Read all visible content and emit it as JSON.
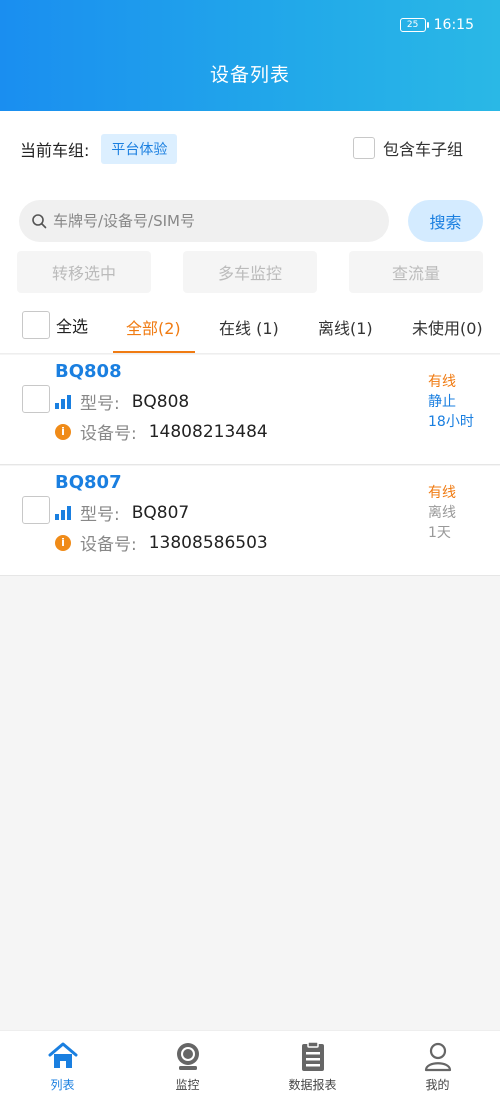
{
  "status_bar": {
    "battery": "25",
    "time": "16:15"
  },
  "header": {
    "title": "设备列表"
  },
  "group": {
    "label": "当前车组:",
    "value": "平台体验",
    "include_subgroup": "包含车子组"
  },
  "search": {
    "placeholder": "车牌号/设备号/SIM号",
    "button": "搜索"
  },
  "actions": [
    "转移选中",
    "多车监控",
    "查流量"
  ],
  "tabs": {
    "select_all": "全选",
    "items": [
      "全部(2)",
      "在线 (1)",
      "离线(1)",
      "未使用(0)"
    ],
    "active": 0
  },
  "devices": [
    {
      "plate": "BQ808",
      "model_label": "型号:",
      "model": "BQ808",
      "imei_label": "设备号:",
      "imei": "14808213484",
      "status": [
        "有线",
        "静止",
        "18小时"
      ]
    },
    {
      "plate": "BQ807",
      "model_label": "型号:",
      "model": "BQ807",
      "imei_label": "设备号:",
      "imei": "13808586503",
      "status": [
        "有线",
        "离线",
        "1天"
      ]
    }
  ],
  "nav": [
    "列表",
    "监控",
    "数据报表",
    "我的"
  ],
  "colors": {
    "primary": "#1a7fe0",
    "accent": "#f07b12",
    "header_start": "#1a8ef0",
    "header_end": "#2ab8e6"
  }
}
